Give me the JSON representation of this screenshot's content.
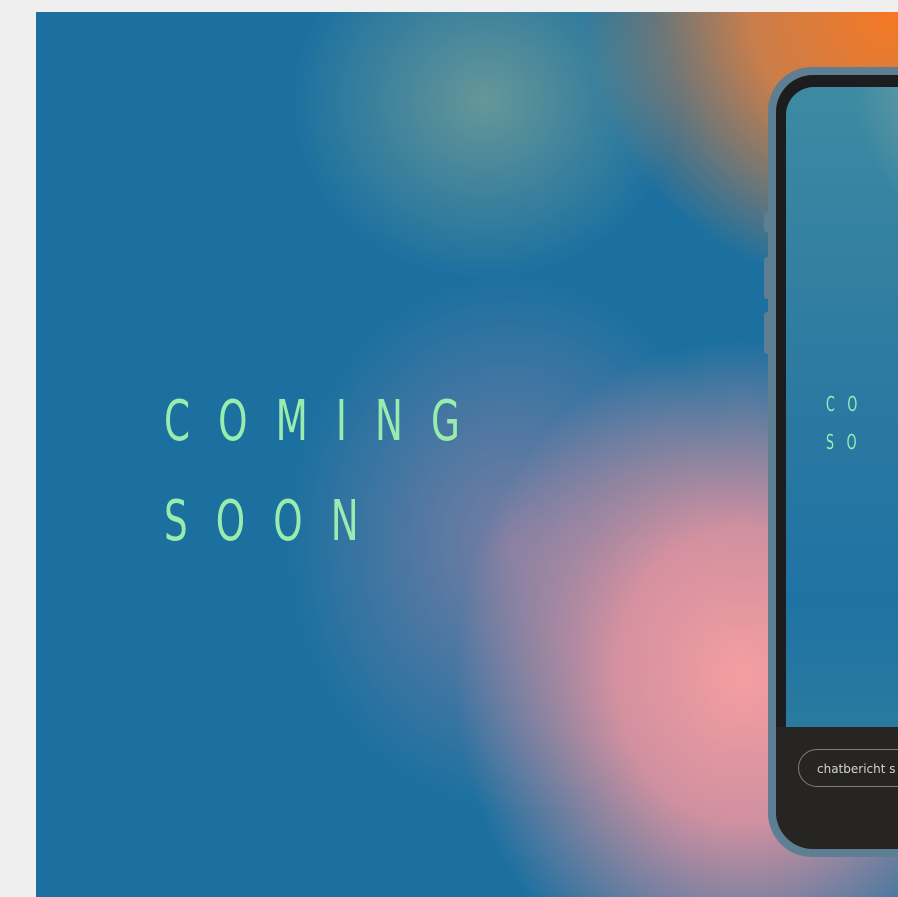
{
  "hero": {
    "line1": "COMING",
    "line2": "SOON"
  },
  "phone_preview": {
    "line1": "CO",
    "line2": "SO",
    "chat_placeholder": "chatbericht s"
  },
  "colors": {
    "text_accent": "#98ecae",
    "background_blue": "#1b70a0",
    "background_orange": "#f77822",
    "background_pink": "#f59ea0",
    "phone_frame": "#5d7e93",
    "phone_bar": "#262524"
  }
}
